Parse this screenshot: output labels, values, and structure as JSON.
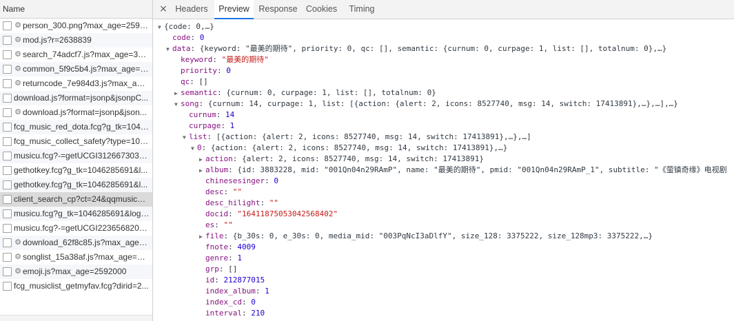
{
  "left": {
    "header": "Name",
    "requests": [
      {
        "name": "person_300.png?max_age=2592...",
        "gear": true
      },
      {
        "name": "mod.js?r=2638839",
        "gear": true
      },
      {
        "name": "search_74adcf7.js?max_age=315...",
        "gear": true
      },
      {
        "name": "common_5f9c5b4.js?max_age=3...",
        "gear": true
      },
      {
        "name": "returncode_7e984d3.js?max_age...",
        "gear": true
      },
      {
        "name": "download.js?format=jsonp&jsonpC...",
        "gear": false
      },
      {
        "name": "download.js?format=jsonp&json...",
        "gear": true
      },
      {
        "name": "fcg_music_red_dota.fcg?g_tk=1046...",
        "gear": false
      },
      {
        "name": "fcg_music_collect_safety?type=100...",
        "gear": false
      },
      {
        "name": "musicu.fcg?-=getUCGI3126673033...",
        "gear": false
      },
      {
        "name": "gethotkey.fcg?g_tk=1046285691&l...",
        "gear": false
      },
      {
        "name": "gethotkey.fcg?g_tk=1046285691&l...",
        "gear": false
      },
      {
        "name": "client_search_cp?ct=24&qqmusic_v...",
        "gear": false,
        "selected": true
      },
      {
        "name": "musicu.fcg?g_tk=1046285691&logi...",
        "gear": false
      },
      {
        "name": "musicu.fcg?-=getUCGI2236568200...",
        "gear": false
      },
      {
        "name": "download_62f8c85.js?max_age=...",
        "gear": true
      },
      {
        "name": "songlist_15a38af.js?max_age=31...",
        "gear": true
      },
      {
        "name": "emoji.js?max_age=2592000",
        "gear": true
      },
      {
        "name": "fcg_musiclist_getmyfav.fcg?dirid=2...",
        "gear": false
      }
    ]
  },
  "tabs": {
    "close": "×",
    "items": [
      "Headers",
      "Preview",
      "Response",
      "Cookies",
      "Timing"
    ],
    "active": 1
  },
  "colors": {
    "key": "#881280",
    "number": "#1c00cf",
    "string": "#c41a16",
    "active_tab": "#1a73e8"
  },
  "preview": {
    "lines": [
      {
        "indent": 0,
        "tri": "down",
        "parts": [
          [
            "sum",
            "{code: 0,…}"
          ]
        ]
      },
      {
        "indent": 1,
        "parts": [
          [
            "key",
            "code"
          ],
          [
            "sum",
            ": "
          ],
          [
            "num",
            "0"
          ]
        ]
      },
      {
        "indent": 1,
        "tri": "down",
        "parts": [
          [
            "key",
            "data"
          ],
          [
            "sum",
            ": {keyword: \"最美的期待\", priority: 0, qc: [], semantic: {curnum: 0, curpage: 1, list: [], totalnum: 0},…}"
          ]
        ]
      },
      {
        "indent": 2,
        "parts": [
          [
            "key",
            "keyword"
          ],
          [
            "sum",
            ": "
          ],
          [
            "str",
            "\"最美的期待\""
          ]
        ]
      },
      {
        "indent": 2,
        "parts": [
          [
            "key",
            "priority"
          ],
          [
            "sum",
            ": "
          ],
          [
            "num",
            "0"
          ]
        ]
      },
      {
        "indent": 2,
        "parts": [
          [
            "key",
            "qc"
          ],
          [
            "sum",
            ": []"
          ]
        ]
      },
      {
        "indent": 2,
        "tri": "right",
        "parts": [
          [
            "key",
            "semantic"
          ],
          [
            "sum",
            ": {curnum: 0, curpage: 1, list: [], totalnum: 0}"
          ]
        ]
      },
      {
        "indent": 2,
        "tri": "down",
        "parts": [
          [
            "key",
            "song"
          ],
          [
            "sum",
            ": {curnum: 14, curpage: 1, list: [{action: {alert: 2, icons: 8527740, msg: 14, switch: 17413891},…},…],…}"
          ]
        ]
      },
      {
        "indent": 3,
        "parts": [
          [
            "key",
            "curnum"
          ],
          [
            "sum",
            ": "
          ],
          [
            "num",
            "14"
          ]
        ]
      },
      {
        "indent": 3,
        "parts": [
          [
            "key",
            "curpage"
          ],
          [
            "sum",
            ": "
          ],
          [
            "num",
            "1"
          ]
        ]
      },
      {
        "indent": 3,
        "tri": "down",
        "parts": [
          [
            "key",
            "list"
          ],
          [
            "sum",
            ": [{action: {alert: 2, icons: 8527740, msg: 14, switch: 17413891},…},…]"
          ]
        ]
      },
      {
        "indent": 4,
        "tri": "down",
        "parts": [
          [
            "key",
            "0"
          ],
          [
            "sum",
            ": {action: {alert: 2, icons: 8527740, msg: 14, switch: 17413891},…}"
          ]
        ]
      },
      {
        "indent": 5,
        "tri": "right",
        "parts": [
          [
            "key",
            "action"
          ],
          [
            "sum",
            ": {alert: 2, icons: 8527740, msg: 14, switch: 17413891}"
          ]
        ]
      },
      {
        "indent": 5,
        "tri": "right",
        "parts": [
          [
            "key",
            "album"
          ],
          [
            "sum",
            ": {id: 3883228, mid: \"001Qn04n29RAmP\", name: \"最美的期待\", pmid: \"001Qn04n29RAmP_1\", subtitle: \"《萤镇奇缘》电视剧"
          ]
        ]
      },
      {
        "indent": 5,
        "parts": [
          [
            "key",
            "chinesesinger"
          ],
          [
            "sum",
            ": "
          ],
          [
            "num",
            "0"
          ]
        ]
      },
      {
        "indent": 5,
        "parts": [
          [
            "key",
            "desc"
          ],
          [
            "sum",
            ": "
          ],
          [
            "str",
            "\"\""
          ]
        ]
      },
      {
        "indent": 5,
        "parts": [
          [
            "key",
            "desc_hilight"
          ],
          [
            "sum",
            ": "
          ],
          [
            "str",
            "\"\""
          ]
        ]
      },
      {
        "indent": 5,
        "parts": [
          [
            "key",
            "docid"
          ],
          [
            "sum",
            ": "
          ],
          [
            "str",
            "\"16411875053042568402\""
          ]
        ]
      },
      {
        "indent": 5,
        "parts": [
          [
            "key",
            "es"
          ],
          [
            "sum",
            ": "
          ],
          [
            "str",
            "\"\""
          ]
        ]
      },
      {
        "indent": 5,
        "tri": "right",
        "parts": [
          [
            "key",
            "file"
          ],
          [
            "sum",
            ": {b_30s: 0, e_30s: 0, media_mid: \"003PqNcI3aDlfY\", size_128: 3375222, size_128mp3: 3375222,…}"
          ]
        ]
      },
      {
        "indent": 5,
        "parts": [
          [
            "key",
            "fnote"
          ],
          [
            "sum",
            ": "
          ],
          [
            "num",
            "4009"
          ]
        ]
      },
      {
        "indent": 5,
        "parts": [
          [
            "key",
            "genre"
          ],
          [
            "sum",
            ": "
          ],
          [
            "num",
            "1"
          ]
        ]
      },
      {
        "indent": 5,
        "parts": [
          [
            "key",
            "grp"
          ],
          [
            "sum",
            ": []"
          ]
        ]
      },
      {
        "indent": 5,
        "parts": [
          [
            "key",
            "id"
          ],
          [
            "sum",
            ": "
          ],
          [
            "num",
            "212877015"
          ]
        ]
      },
      {
        "indent": 5,
        "parts": [
          [
            "key",
            "index_album"
          ],
          [
            "sum",
            ": "
          ],
          [
            "num",
            "1"
          ]
        ]
      },
      {
        "indent": 5,
        "parts": [
          [
            "key",
            "index_cd"
          ],
          [
            "sum",
            ": "
          ],
          [
            "num",
            "0"
          ]
        ]
      },
      {
        "indent": 5,
        "parts": [
          [
            "key",
            "interval"
          ],
          [
            "sum",
            ": "
          ],
          [
            "num",
            "210"
          ]
        ]
      }
    ]
  }
}
